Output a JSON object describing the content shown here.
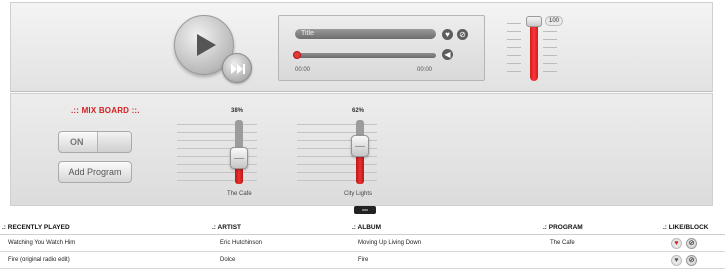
{
  "player": {
    "track_title": "Title",
    "elapsed": "00:00",
    "duration": "00:00",
    "volume_label": "100",
    "volume_level": 1.0,
    "seek_fraction": 0.0
  },
  "mixboard": {
    "title": ".:: MIX BOARD ::.",
    "toggle_label": "ON",
    "add_program_label": "Add Program",
    "faders": [
      {
        "name": "The Cafe",
        "percent_label": "38%",
        "level": 0.38
      },
      {
        "name": "City Lights",
        "percent_label": "62%",
        "level": 0.62
      }
    ]
  },
  "table": {
    "headers": {
      "recently_played": ".: RECENTLY PLAYED",
      "artist": ".: ARTIST",
      "album": ".: ALBUM",
      "program": ".: PROGRAM",
      "like_block": ".: LIKE/BLOCK"
    },
    "rows": [
      {
        "title": "Watching You Watch Him",
        "artist": "Eric Hutchinson",
        "album": "Moving Up Living Down",
        "program": "The Cafe",
        "liked": true
      },
      {
        "title": "Fire (original radio edit)",
        "artist": "Dolce",
        "album": "Fire",
        "program": "",
        "liked": false
      }
    ]
  },
  "colors": {
    "accent": "#d21f1f",
    "panel": "#e6e6e6"
  },
  "icons": [
    "play-icon",
    "skip-forward-icon",
    "heart-icon",
    "block-icon",
    "volume-icon"
  ]
}
